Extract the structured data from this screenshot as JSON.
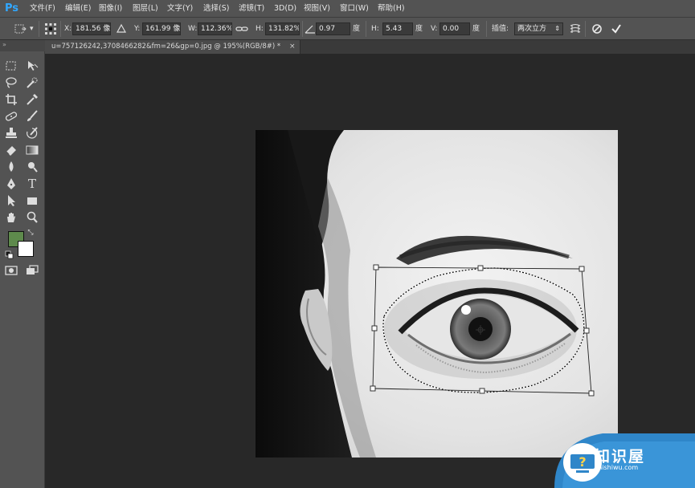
{
  "app": {
    "logo": "Ps",
    "brand_color": "#31a8ff"
  },
  "menu": {
    "items": [
      "文件(F)",
      "编辑(E)",
      "图像(I)",
      "图层(L)",
      "文字(Y)",
      "选择(S)",
      "滤镜(T)",
      "3D(D)",
      "视图(V)",
      "窗口(W)",
      "帮助(H)"
    ]
  },
  "options": {
    "x_label": "X:",
    "x_value": "181.56 像",
    "y_label": "Y:",
    "y_value": "161.99 像",
    "w_label": "W:",
    "w_value": "112.36%",
    "h_label": "H:",
    "h_value": "131.82%",
    "angle_value": "0.97",
    "angle_unit": "度",
    "skew_h_label": "H:",
    "skew_h_value": "5.43",
    "skew_h_unit": "度",
    "skew_v_label": "V:",
    "skew_v_value": "0.00",
    "skew_v_unit": "度",
    "interp_label": "插值:",
    "interp_value": "两次立方",
    "icons": {
      "tool_preset": "transform-tool-icon",
      "reference_point": "reference-point-icon",
      "delta": "relative-position-icon",
      "link": "link-icon",
      "angle": "angle-icon",
      "warp": "warp-icon",
      "cancel": "cancel-icon",
      "commit": "commit-icon"
    }
  },
  "document": {
    "tab_title": "u=757126242,3708466282&fm=26&gp=0.jpg @ 195%(RGB/8#) *",
    "tab_close": "×"
  },
  "toolbox": {
    "foreground_color": "#5e8a4c",
    "background_color": "#ffffff",
    "tools": [
      "marquee-icon",
      "move-icon",
      "lasso-icon",
      "quick-select-icon",
      "crop-icon",
      "eyedropper-icon",
      "healing-icon",
      "brush-icon",
      "clone-stamp-icon",
      "history-brush-icon",
      "eraser-icon",
      "gradient-icon",
      "blur-icon",
      "dodge-icon",
      "pen-icon",
      "type-icon",
      "path-select-icon",
      "rectangle-icon",
      "hand-icon",
      "zoom-icon",
      "quick-mask-icon",
      "screen-mode-icon"
    ]
  },
  "watermark": {
    "title": "知识屋",
    "subtitle": "zhishiwu.com"
  }
}
